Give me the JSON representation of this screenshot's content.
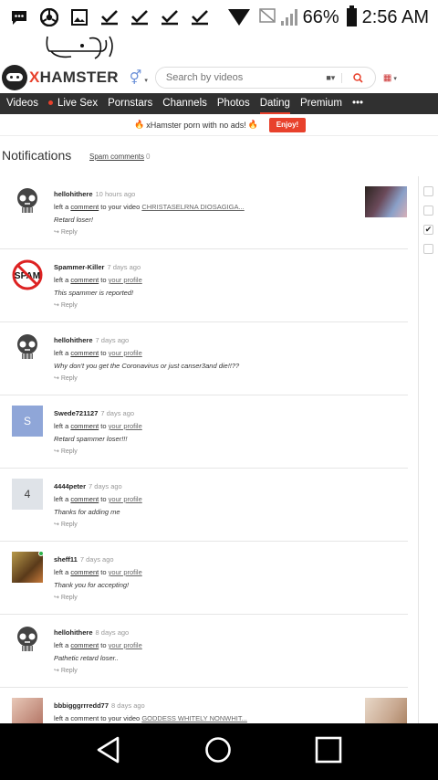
{
  "status_bar": {
    "battery": "66%",
    "time": "2:56 AM",
    "icons": [
      "message-icon",
      "chrome-icon",
      "gallery-icon",
      "check-icon",
      "check-icon",
      "check-icon",
      "check-icon",
      "wifi-icon",
      "no-sim-icon",
      "signal-icon",
      "battery-icon"
    ]
  },
  "header": {
    "logo_x": "X",
    "logo_rest": "HAMSTER",
    "search_placeholder": "Search by videos",
    "accent": "#e8412c"
  },
  "nav": {
    "items": [
      "Videos",
      "Live Sex",
      "Pornstars",
      "Channels",
      "Photos",
      "Dating",
      "Premium",
      "•••"
    ],
    "active": "Dating"
  },
  "promo": {
    "text": "xHamster porn with no ads!",
    "button": "Enjoy!"
  },
  "notifications": {
    "title": "Notifications",
    "spam_label": "Spam comments",
    "spam_count": "0",
    "items": [
      {
        "user": "hellohithere",
        "time": "10 hours ago",
        "action": "left a",
        "link": "comment",
        "to": "to your video",
        "target": "CHRISTASELRNA DIOSAGIGA...",
        "message": "Retard loser!",
        "reply": "Reply",
        "avatar": "skull",
        "thumb": true
      },
      {
        "user": "Spammer-Killer",
        "time": "7 days ago",
        "action": "left a",
        "link": "comment",
        "to": "to",
        "target": "your profile",
        "message": "This spammer is reported!",
        "reply": "Reply",
        "avatar": "spam"
      },
      {
        "user": "hellohithere",
        "time": "7 days ago",
        "action": "left a",
        "link": "comment",
        "to": "to",
        "target": "your profile",
        "message": "Why don't you get the Coronavirus or just canser3and die!!??",
        "reply": "Reply",
        "avatar": "skull"
      },
      {
        "user": "Swede721127",
        "time": "7 days ago",
        "action": "left a",
        "link": "comment",
        "to": "to",
        "target": "your profile",
        "message": "Retard spammer loser!!!",
        "reply": "Reply",
        "avatar": "S"
      },
      {
        "user": "4444peter",
        "time": "7 days ago",
        "action": "left a",
        "link": "comment",
        "to": "to",
        "target": "your profile",
        "message": "Thanks for adding me",
        "reply": "Reply",
        "avatar": "4"
      },
      {
        "user": "sheff11",
        "time": "7 days ago",
        "action": "left a",
        "link": "comment",
        "to": "to",
        "target": "your profile",
        "message": "Thank you for accepting!",
        "reply": "Reply",
        "avatar": "photo"
      },
      {
        "user": "hellohithere",
        "time": "8 days ago",
        "action": "left a",
        "link": "comment",
        "to": "to",
        "target": "your profile",
        "message": "Pathetic retard loser..",
        "reply": "Reply",
        "avatar": "skull"
      },
      {
        "user": "bbbigggrrredd77",
        "time": "8 days ago",
        "action": "left a comment to your video",
        "link": "",
        "to": "",
        "target": "GODDESS WHITELY NONWHIT...",
        "message": "",
        "reply": "",
        "avatar": "photo2",
        "thumb": true
      }
    ]
  },
  "checkboxes": [
    false,
    false,
    true,
    false
  ]
}
